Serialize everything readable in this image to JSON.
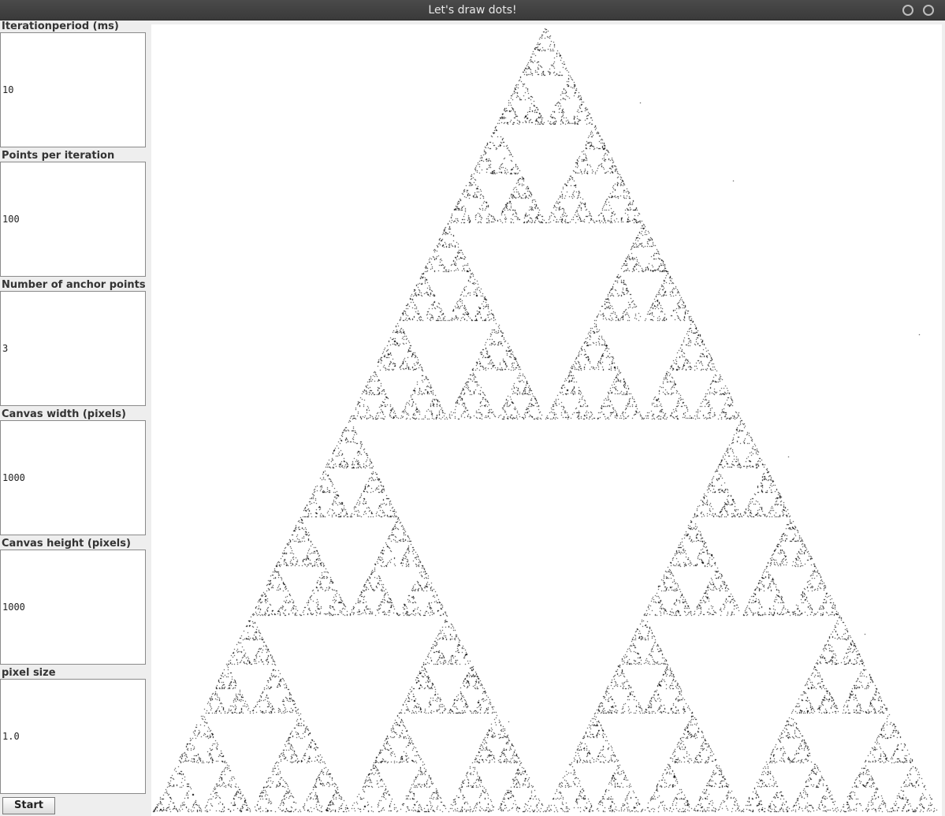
{
  "window": {
    "title": "Let's draw dots!"
  },
  "controls": {
    "fields": [
      {
        "label": "Iterationperiod (ms)",
        "value": "10"
      },
      {
        "label": "Points per iteration",
        "value": "100"
      },
      {
        "label": "Number of anchor points",
        "value": "3"
      },
      {
        "label": "Canvas width (pixels)",
        "value": "1000"
      },
      {
        "label": "Canvas height (pixels)",
        "value": "1000"
      },
      {
        "label": "pixel size",
        "value": "1.0"
      }
    ],
    "start_label": "Start"
  },
  "canvas": {
    "background": "#ffffff",
    "dot_color": "#000000",
    "pattern": "sierpinski-triangle-chaos-game"
  }
}
